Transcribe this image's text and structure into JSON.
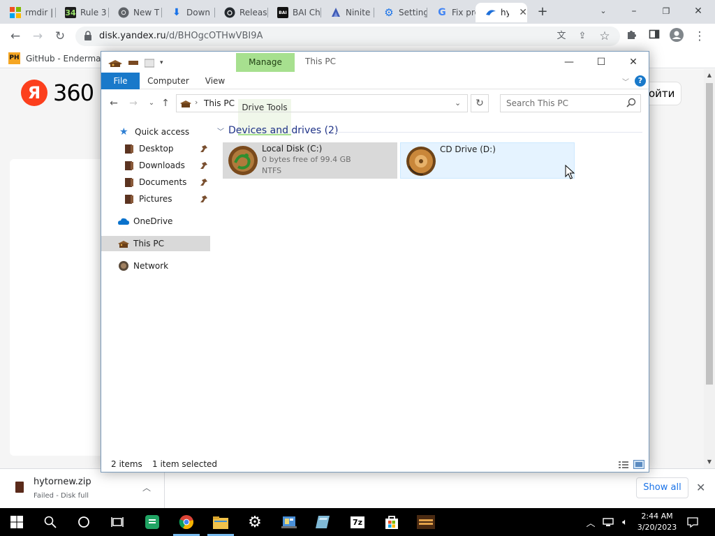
{
  "browser": {
    "tabs": [
      {
        "label": "rmdir |",
        "favicon": "windows-icon"
      },
      {
        "label": "Rule 3",
        "favicon": "rule34-icon"
      },
      {
        "label": "New T",
        "favicon": "chrome-icon"
      },
      {
        "label": "Down",
        "favicon": "download-icon"
      },
      {
        "label": "Releas",
        "favicon": "github-icon"
      },
      {
        "label": "BAI Ch",
        "favicon": "bai-icon"
      },
      {
        "label": "Ninite",
        "favicon": "ninite-icon"
      },
      {
        "label": "Setting",
        "favicon": "gear-icon"
      },
      {
        "label": "Fix pro",
        "favicon": "google-icon"
      },
      {
        "label": "hyt",
        "favicon": "yandex-disk-icon"
      }
    ],
    "url_host": "disk.yandex.ru",
    "url_path": "/d/BHOgcOTHwVBI9A",
    "bookmark": "GitHub - Enderman...",
    "bookmark_badge": "PH"
  },
  "yandex": {
    "logo_letter": "Я",
    "logo_text": "360",
    "login_fragment": "ойти"
  },
  "download": {
    "filename": "hytornew.zip",
    "status": "Failed - Disk full",
    "show_all": "Show all"
  },
  "explorer": {
    "title": "This PC",
    "manage": "Manage",
    "ribbon_tabs": [
      "File",
      "Computer",
      "View",
      "Drive Tools"
    ],
    "address": "This PC",
    "search_placeholder": "Search This PC",
    "help": "?",
    "nav": {
      "quick_access": "Quick access",
      "pinned": [
        "Desktop",
        "Downloads",
        "Documents",
        "Pictures"
      ],
      "onedrive": "OneDrive",
      "this_pc": "This PC",
      "network": "Network"
    },
    "group_header": "Devices and drives (2)",
    "drives": [
      {
        "name": "Local Disk (C:)",
        "free": "0 bytes free of 99.4 GB",
        "fs": "NTFS"
      },
      {
        "name": "CD Drive (D:)"
      }
    ],
    "status_count": "2 items",
    "status_selected": "1 item selected"
  },
  "taskbar": {
    "time": "2:44 AM",
    "date": "3/20/2023"
  },
  "colors": {
    "ribbon_file": "#1979ca",
    "manage_green": "#a7e08f",
    "selected_gray": "#d9d9d9",
    "hover_blue": "#e5f3ff",
    "yandex_red": "#fc3f1d"
  }
}
